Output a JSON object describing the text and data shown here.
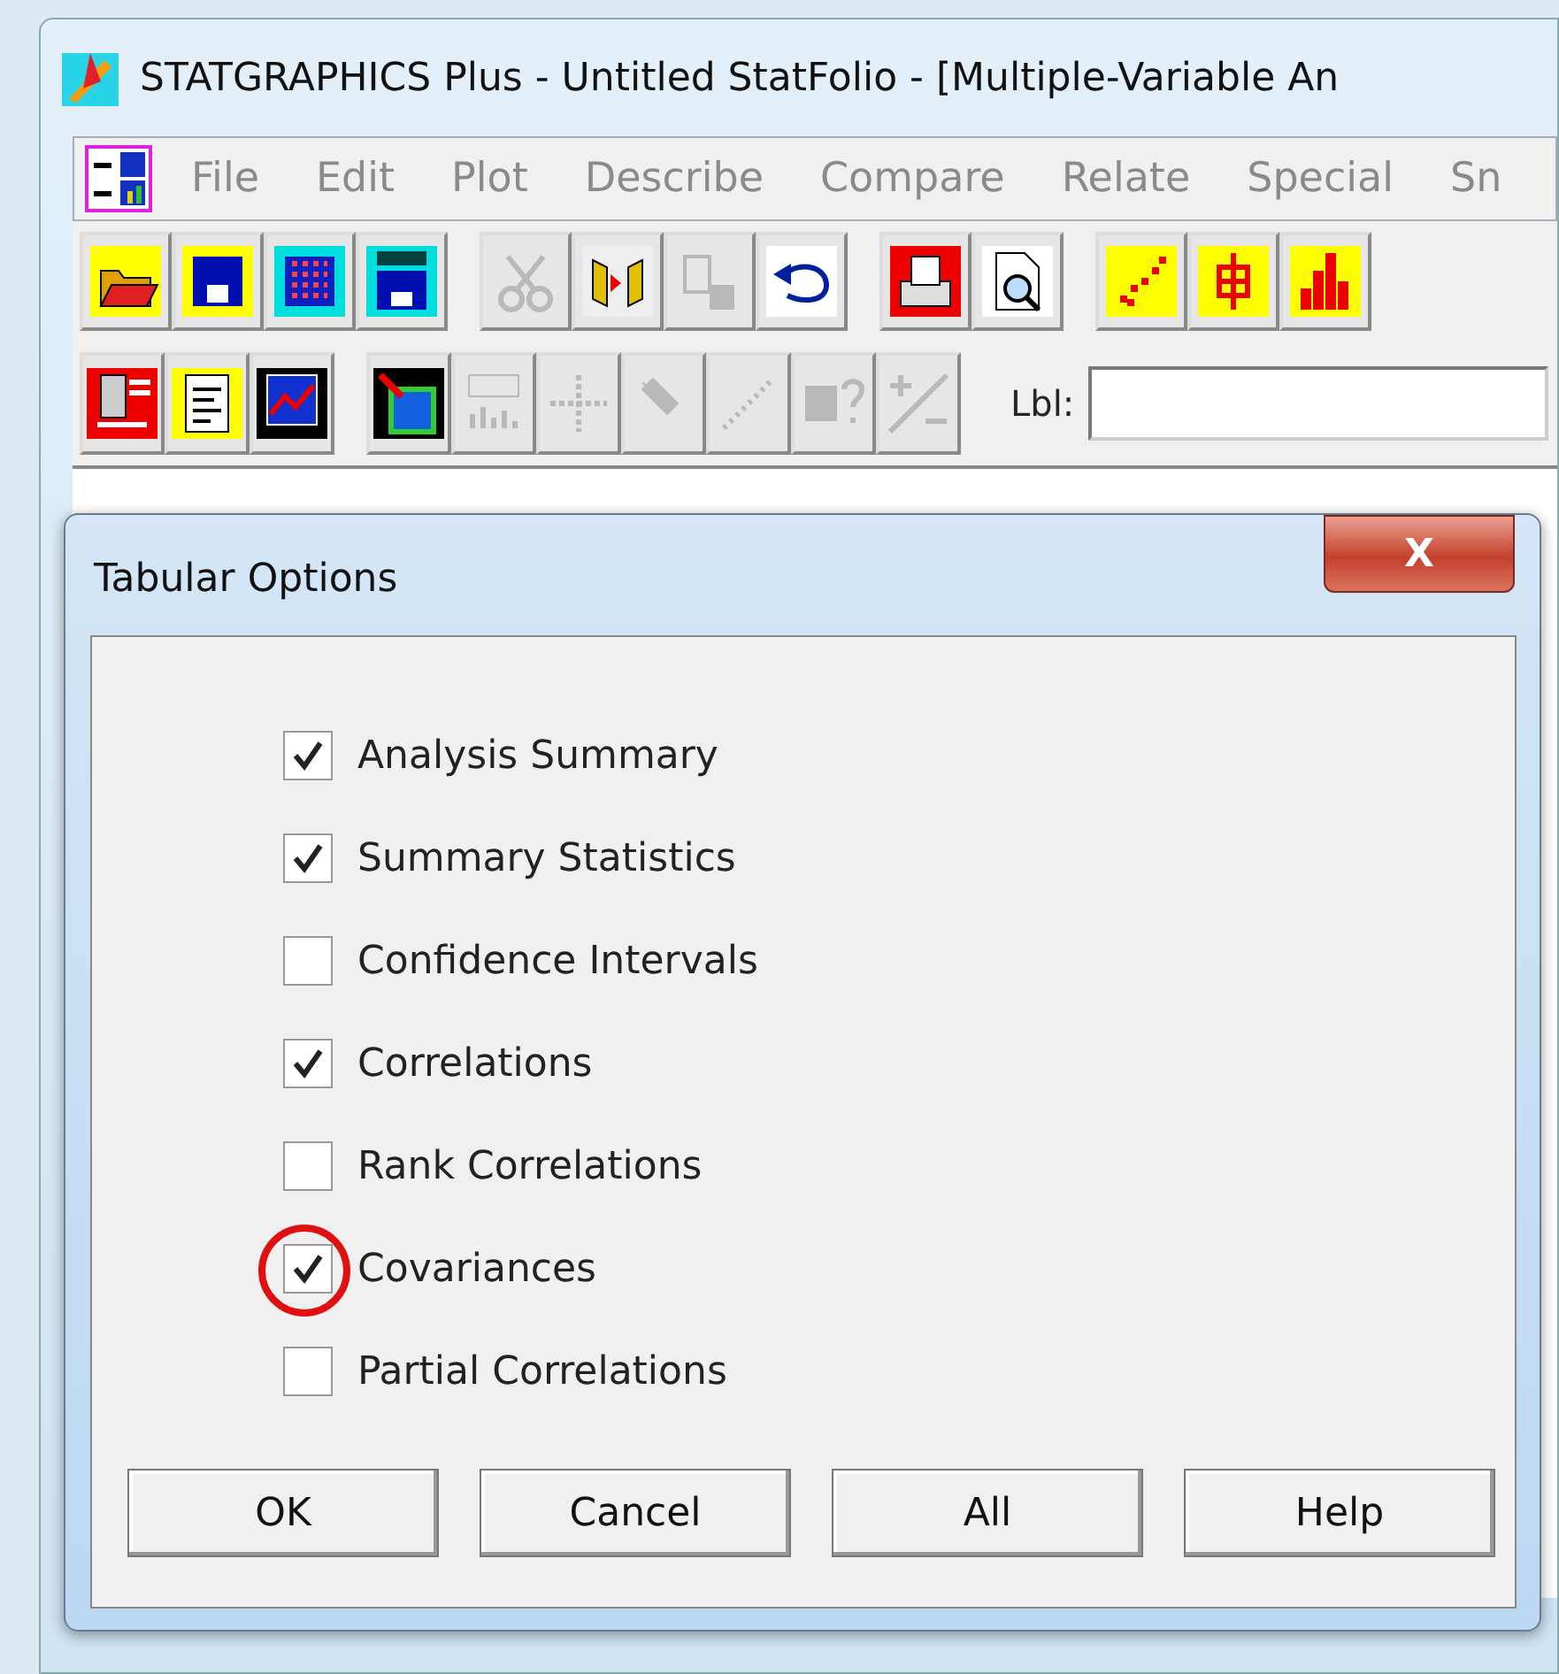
{
  "window": {
    "title": "STATGRAPHICS Plus - Untitled StatFolio - [Multiple-Variable An"
  },
  "menu": [
    "File",
    "Edit",
    "Plot",
    "Describe",
    "Compare",
    "Relate",
    "Special",
    "Sn"
  ],
  "toolbar_1": [
    {
      "disabled": false
    },
    {
      "disabled": false
    },
    {
      "disabled": false
    },
    {
      "disabled": false
    },
    {
      "disabled": true
    },
    {
      "disabled": false
    },
    {
      "disabled": true
    },
    {
      "disabled": false
    },
    {
      "disabled": false
    },
    {
      "disabled": false
    },
    {
      "disabled": false
    },
    {
      "disabled": false
    },
    {
      "disabled": false
    }
  ],
  "toolbar_2": [
    {
      "disabled": false
    },
    {
      "disabled": false
    },
    {
      "disabled": false
    },
    {
      "disabled": false
    },
    {
      "disabled": true
    },
    {
      "disabled": true
    },
    {
      "disabled": true
    },
    {
      "disabled": true
    },
    {
      "disabled": true
    },
    {
      "disabled": true
    }
  ],
  "label_field": {
    "label": "Lbl:"
  },
  "dialog": {
    "title": "Tabular Options",
    "close": "X",
    "items": [
      {
        "label": "Analysis Summary",
        "checked": true,
        "circled": false
      },
      {
        "label": "Summary Statistics",
        "checked": true,
        "circled": false
      },
      {
        "label": "Confidence Intervals",
        "checked": false,
        "circled": false
      },
      {
        "label": "Correlations",
        "checked": true,
        "circled": false
      },
      {
        "label": "Rank Correlations",
        "checked": false,
        "circled": false
      },
      {
        "label": "Covariances",
        "checked": true,
        "circled": true
      },
      {
        "label": "Partial Correlations",
        "checked": false,
        "circled": false
      }
    ],
    "buttons": [
      "OK",
      "Cancel",
      "All",
      "Help"
    ]
  }
}
